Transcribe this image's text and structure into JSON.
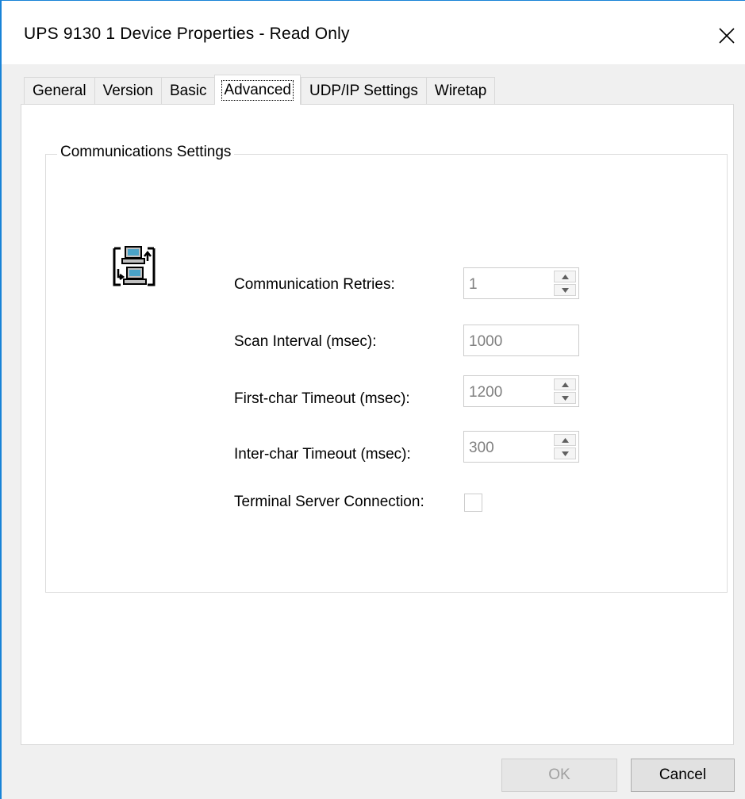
{
  "window": {
    "title": "UPS 9130 1 Device Properties - Read Only",
    "accent_color": "#1883d7"
  },
  "tabs": [
    {
      "label": "General",
      "active": false
    },
    {
      "label": "Version",
      "active": false
    },
    {
      "label": "Basic",
      "active": false
    },
    {
      "label": "Advanced",
      "active": true
    },
    {
      "label": "UDP/IP Settings",
      "active": false
    },
    {
      "label": "Wiretap",
      "active": false
    }
  ],
  "group": {
    "title": "Communications Settings",
    "icon": "computers-exchange-icon"
  },
  "fields": {
    "retries": {
      "label": "Communication Retries:",
      "value": "1"
    },
    "scan_interval": {
      "label": "Scan Interval (msec):",
      "value": "1000"
    },
    "first_char": {
      "label": "First-char Timeout (msec):",
      "value": "1200"
    },
    "inter_char": {
      "label": "Inter-char Timeout (msec):",
      "value": "300"
    },
    "terminal_server": {
      "label": "Terminal Server Connection:",
      "checked": false
    }
  },
  "buttons": {
    "ok": "OK",
    "cancel": "Cancel"
  }
}
